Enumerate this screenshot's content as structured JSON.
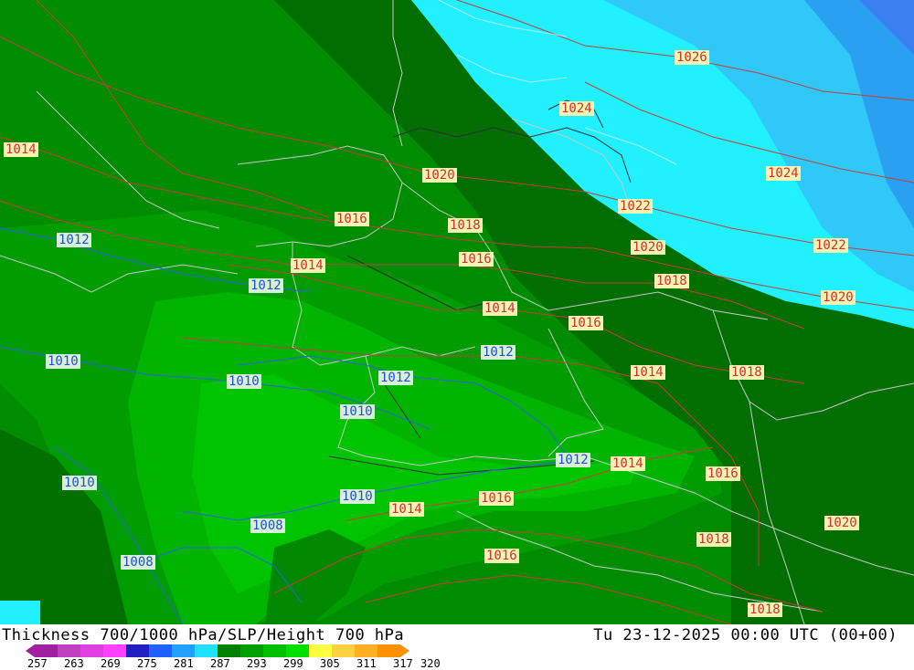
{
  "title": "Thickness 700/1000 hPa/SLP/Height 700 hPa",
  "valid_time": "Tu 23-12-2025 00:00 UTC (00+00)",
  "colorbar": {
    "ticks": [
      "257",
      "263",
      "269",
      "275",
      "281",
      "287",
      "293",
      "299",
      "305",
      "311",
      "317",
      "320"
    ],
    "colors": [
      "#a020a0",
      "#c040c0",
      "#e040e0",
      "#ff40ff",
      "#2020c0",
      "#2060ff",
      "#20a0ff",
      "#20e0ff",
      "#008000",
      "#00a000",
      "#00c000",
      "#00e000",
      "#ffff40",
      "#ffd040",
      "#ffb020",
      "#ff9000"
    ]
  },
  "isobars": [
    {
      "label": "1026",
      "color": "red"
    },
    {
      "label": "1024",
      "color": "red"
    },
    {
      "label": "1014",
      "color": "red"
    },
    {
      "label": "1020",
      "color": "red"
    },
    {
      "label": "1024",
      "color": "red"
    },
    {
      "label": "1022",
      "color": "red"
    },
    {
      "label": "1016",
      "color": "red"
    },
    {
      "label": "1018",
      "color": "red"
    },
    {
      "label": "1012",
      "color": "blue"
    },
    {
      "label": "1020",
      "color": "red"
    },
    {
      "label": "1022",
      "color": "red"
    },
    {
      "label": "1016",
      "color": "red"
    },
    {
      "label": "1014",
      "color": "red"
    },
    {
      "label": "1018",
      "color": "red"
    },
    {
      "label": "1012",
      "color": "blue"
    },
    {
      "label": "1020",
      "color": "red"
    },
    {
      "label": "1014",
      "color": "red"
    },
    {
      "label": "1016",
      "color": "red"
    },
    {
      "label": "1012",
      "color": "blue"
    },
    {
      "label": "1010",
      "color": "blue"
    },
    {
      "label": "1014",
      "color": "red"
    },
    {
      "label": "1018",
      "color": "red"
    },
    {
      "label": "1010",
      "color": "blue"
    },
    {
      "label": "1012",
      "color": "blue"
    },
    {
      "label": "1010",
      "color": "blue"
    },
    {
      "label": "1012",
      "color": "blue"
    },
    {
      "label": "1014",
      "color": "red"
    },
    {
      "label": "1016",
      "color": "red"
    },
    {
      "label": "1010",
      "color": "blue"
    },
    {
      "label": "1010",
      "color": "blue"
    },
    {
      "label": "1016",
      "color": "red"
    },
    {
      "label": "1014",
      "color": "red"
    },
    {
      "label": "1008",
      "color": "blue"
    },
    {
      "label": "1020",
      "color": "red"
    },
    {
      "label": "1018",
      "color": "red"
    },
    {
      "label": "1016",
      "color": "red"
    },
    {
      "label": "1008",
      "color": "blue"
    },
    {
      "label": "1018",
      "color": "red"
    }
  ]
}
